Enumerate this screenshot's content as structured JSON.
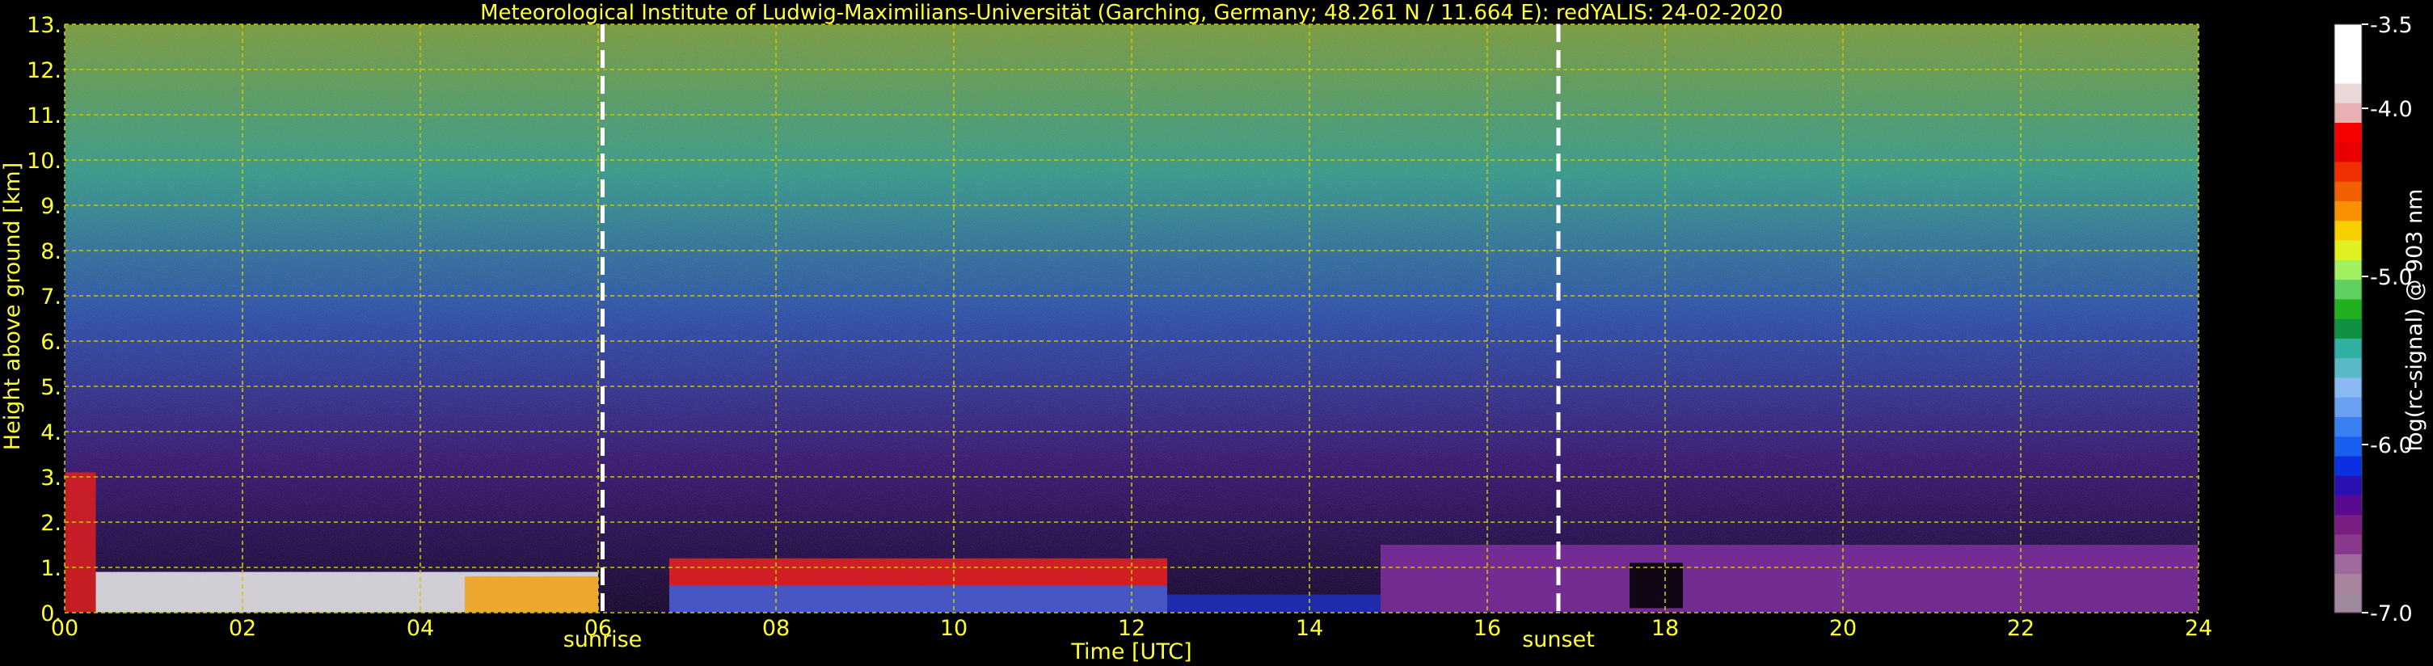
{
  "chart_data": {
    "type": "heatmap",
    "title": "Meteorological Institute of Ludwig-Maximilians-Universität (Garching, Germany; 48.261 N / 11.664 E):    redYALIS: 24-02-2020",
    "xlabel": "Time [UTC]",
    "ylabel": "Height above ground [km]",
    "xlim": [
      0,
      24
    ],
    "ylim": [
      0,
      13
    ],
    "xticks": [
      {
        "value": 0,
        "label": "00"
      },
      {
        "value": 2,
        "label": "02"
      },
      {
        "value": 4,
        "label": "04"
      },
      {
        "value": 6,
        "label": "06"
      },
      {
        "value": 8,
        "label": "08"
      },
      {
        "value": 10,
        "label": "10"
      },
      {
        "value": 12,
        "label": "12"
      },
      {
        "value": 14,
        "label": "14"
      },
      {
        "value": 16,
        "label": "16"
      },
      {
        "value": 18,
        "label": "18"
      },
      {
        "value": 20,
        "label": "20"
      },
      {
        "value": 22,
        "label": "22"
      },
      {
        "value": 24,
        "label": "24"
      }
    ],
    "yticks": [
      {
        "value": 0,
        "label": "0."
      },
      {
        "value": 1,
        "label": "1."
      },
      {
        "value": 2,
        "label": "2."
      },
      {
        "value": 3,
        "label": "3."
      },
      {
        "value": 4,
        "label": "4."
      },
      {
        "value": 5,
        "label": "5."
      },
      {
        "value": 6,
        "label": "6."
      },
      {
        "value": 7,
        "label": "7."
      },
      {
        "value": 8,
        "label": "8."
      },
      {
        "value": 9,
        "label": "9."
      },
      {
        "value": 10,
        "label": "10."
      },
      {
        "value": 11,
        "label": "11."
      },
      {
        "value": 12,
        "label": "12."
      },
      {
        "value": 13,
        "label": "13."
      }
    ],
    "grid": true,
    "annotations": [
      {
        "text": "sunrise",
        "x": 6.05
      },
      {
        "text": "sunset",
        "x": 16.8
      }
    ],
    "colorbar": {
      "label": "log(rc-signal) @ 903 nm",
      "range": [
        -7.0,
        -3.5
      ],
      "ticks": [
        {
          "value": -3.5,
          "label": "-3.5"
        },
        {
          "value": -4.0,
          "label": "-4.0"
        },
        {
          "value": -5.0,
          "label": "-5.0"
        },
        {
          "value": -6.0,
          "label": "-6.0"
        },
        {
          "value": -7.0,
          "label": "-7.0"
        }
      ],
      "colors": [
        "#9e8a9e",
        "#a8849e",
        "#a06a9c",
        "#8a3a8c",
        "#7a1e84",
        "#5a0a90",
        "#2a10b0",
        "#0a30e0",
        "#1a60f0",
        "#3a80f0",
        "#6aa0f0",
        "#8ab8f0",
        "#5ab8c8",
        "#30b0a0",
        "#109040",
        "#20b020",
        "#60d060",
        "#a0f060",
        "#e0f020",
        "#f8d000",
        "#f89000",
        "#f06000",
        "#f03000",
        "#e80000",
        "#f80000",
        "#e8b0b0",
        "#e8d8d8",
        "#ffffff",
        "#ffffff",
        "#ffffff"
      ]
    },
    "colors": {
      "axis_text": "#ffff33",
      "grid": "#c8c800",
      "background": "#000000",
      "marker_lines": "#ffffff"
    }
  }
}
